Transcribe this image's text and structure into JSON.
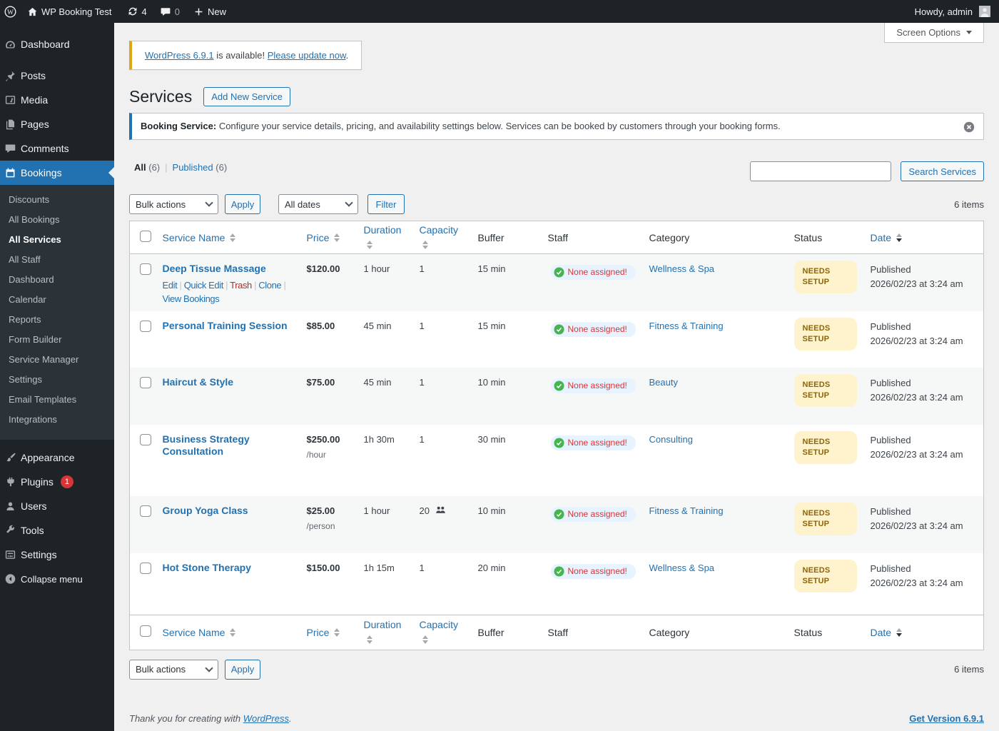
{
  "colors": {
    "accent": "#2271b1",
    "bar_bg": "#1d2327",
    "update_border": "#dba617",
    "danger": "#b32d2e",
    "status_bg": "#fff3cd",
    "status_text": "#8d6509",
    "staff_bg": "#e7f3ff",
    "alert_red": "#d63638",
    "check_green": "#46b450"
  },
  "admin_bar": {
    "site_name": "WP Booking Test",
    "updates_count": "4",
    "comments_count": "0",
    "new_label": "New",
    "howdy": "Howdy, admin"
  },
  "screen_options_label": "Screen Options",
  "sidebar": {
    "items": [
      {
        "label": "Dashboard"
      },
      {
        "label": "Posts"
      },
      {
        "label": "Media"
      },
      {
        "label": "Pages"
      },
      {
        "label": "Comments"
      },
      {
        "label": "Bookings"
      }
    ],
    "submenu": [
      {
        "label": "Discounts"
      },
      {
        "label": "All Bookings"
      },
      {
        "label": "All Services",
        "current": true
      },
      {
        "label": "All Staff"
      },
      {
        "label": "Dashboard"
      },
      {
        "label": "Calendar"
      },
      {
        "label": "Reports"
      },
      {
        "label": "Form Builder"
      },
      {
        "label": "Service Manager"
      },
      {
        "label": "Settings"
      },
      {
        "label": "Email Templates"
      },
      {
        "label": "Integrations"
      }
    ],
    "lower": [
      {
        "label": "Appearance"
      },
      {
        "label": "Plugins",
        "badge": "1"
      },
      {
        "label": "Users"
      },
      {
        "label": "Tools"
      },
      {
        "label": "Settings"
      }
    ],
    "collapse_label": "Collapse menu"
  },
  "update_notice": {
    "link_version": "WordPress 6.9.1",
    "text_available": " is available! ",
    "link_update": "Please update now",
    "period": "."
  },
  "page": {
    "title": "Services",
    "add_new_label": "Add New Service"
  },
  "info_notice": {
    "bold": "Booking Service:",
    "text": " Configure your service details, pricing, and availability settings below. Services can be booked by customers through your booking forms."
  },
  "views": {
    "all": "All",
    "all_count": "(6)",
    "published": "Published",
    "published_count": "(6)"
  },
  "search_button": "Search Services",
  "tablenav": {
    "bulk_actions": "Bulk actions",
    "apply": "Apply",
    "all_dates": "All dates",
    "filter": "Filter",
    "items_count": "6 items"
  },
  "table": {
    "columns": [
      {
        "label": "Service Name",
        "sortable": true
      },
      {
        "label": "Price",
        "sortable": true
      },
      {
        "label": "Duration",
        "sortable": true
      },
      {
        "label": "Capacity",
        "sortable": true
      },
      {
        "label": "Buffer"
      },
      {
        "label": "Staff"
      },
      {
        "label": "Category"
      },
      {
        "label": "Status"
      },
      {
        "label": "Date",
        "sortable": true,
        "sorted": "desc"
      }
    ],
    "row_actions": [
      {
        "label": "Edit"
      },
      {
        "label": "Quick Edit"
      },
      {
        "label": "Trash",
        "danger": true
      },
      {
        "label": "Clone"
      },
      {
        "label": "View Bookings"
      }
    ],
    "staff_none_label": "None assigned!",
    "status_label": "NEEDS SETUP",
    "rows": [
      {
        "name": "Deep Tissue Massage",
        "price": "$120.00",
        "price_unit": "",
        "duration": "1 hour",
        "capacity": "1",
        "capacity_group": false,
        "buffer": "15 min",
        "category": "Wellness & Spa",
        "date_line1": "Published",
        "date_line2": "2026/02/23 at 3:24 am",
        "show_actions": true
      },
      {
        "name": "Personal Training Session",
        "price": "$85.00",
        "price_unit": "",
        "duration": "45 min",
        "capacity": "1",
        "capacity_group": false,
        "buffer": "15 min",
        "category": "Fitness & Training",
        "date_line1": "Published",
        "date_line2": "2026/02/23 at 3:24 am"
      },
      {
        "name": "Haircut & Style",
        "price": "$75.00",
        "price_unit": "",
        "duration": "45 min",
        "capacity": "1",
        "capacity_group": false,
        "buffer": "10 min",
        "category": "Beauty",
        "date_line1": "Published",
        "date_line2": "2026/02/23 at 3:24 am"
      },
      {
        "name": "Business Strategy Consultation",
        "price": "$250.00",
        "price_unit": "/hour",
        "duration": "1h 30m",
        "capacity": "1",
        "capacity_group": false,
        "buffer": "30 min",
        "category": "Consulting",
        "date_line1": "Published",
        "date_line2": "2026/02/23 at 3:24 am"
      },
      {
        "name": "Group Yoga Class",
        "price": "$25.00",
        "price_unit": "/person",
        "duration": "1 hour",
        "capacity": "20",
        "capacity_group": true,
        "buffer": "10 min",
        "category": "Fitness & Training",
        "date_line1": "Published",
        "date_line2": "2026/02/23 at 3:24 am"
      },
      {
        "name": "Hot Stone Therapy",
        "price": "$150.00",
        "price_unit": "",
        "duration": "1h 15m",
        "capacity": "1",
        "capacity_group": false,
        "buffer": "20 min",
        "category": "Wellness & Spa",
        "date_line1": "Published",
        "date_line2": "2026/02/23 at 3:24 am"
      }
    ]
  },
  "footer": {
    "thanks_prefix": "Thank you for creating with ",
    "thanks_link": "WordPress",
    "thanks_suffix": ".",
    "version_link": "Get Version 6.9.1"
  }
}
